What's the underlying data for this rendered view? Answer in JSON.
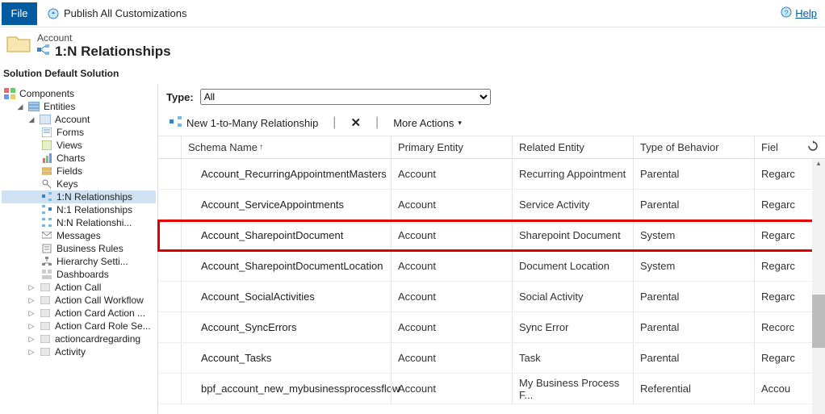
{
  "topbar": {
    "file": "File",
    "publish": "Publish All Customizations",
    "help": "Help"
  },
  "header": {
    "breadcrumb": "Account",
    "title": "1:N Relationships"
  },
  "solution_label": "Solution Default Solution",
  "tree": {
    "components": "Components",
    "entities": "Entities",
    "account": "Account",
    "forms": "Forms",
    "views": "Views",
    "charts": "Charts",
    "fields": "Fields",
    "keys": "Keys",
    "rel_1n": "1:N Relationships",
    "rel_n1": "N:1 Relationships",
    "rel_nn": "N:N Relationshi...",
    "messages": "Messages",
    "business_rules": "Business Rules",
    "hierarchy": "Hierarchy Setti...",
    "dashboards": "Dashboards",
    "action_call": "Action Call",
    "action_call_wf": "Action Call Workflow",
    "action_card_action": "Action Card Action ...",
    "action_card_role": "Action Card Role Se...",
    "actioncardregarding": "actioncardregarding",
    "activity": "Activity"
  },
  "type_row": {
    "label": "Type:",
    "value": "All"
  },
  "toolbar": {
    "new_rel": "New 1-to-Many Relationship",
    "more": "More Actions"
  },
  "columns": {
    "schema": "Schema Name",
    "primary": "Primary Entity",
    "related": "Related Entity",
    "type": "Type of Behavior",
    "field": "Fiel"
  },
  "rows": [
    {
      "schema": "Account_RecurringAppointmentMasters",
      "primary": "Account",
      "related": "Recurring Appointment",
      "type": "Parental",
      "field": "Regarc"
    },
    {
      "schema": "Account_ServiceAppointments",
      "primary": "Account",
      "related": "Service Activity",
      "type": "Parental",
      "field": "Regarc"
    },
    {
      "schema": "Account_SharepointDocument",
      "primary": "Account",
      "related": "Sharepoint Document",
      "type": "System",
      "field": "Regarc"
    },
    {
      "schema": "Account_SharepointDocumentLocation",
      "primary": "Account",
      "related": "Document Location",
      "type": "System",
      "field": "Regarc"
    },
    {
      "schema": "Account_SocialActivities",
      "primary": "Account",
      "related": "Social Activity",
      "type": "Parental",
      "field": "Regarc"
    },
    {
      "schema": "Account_SyncErrors",
      "primary": "Account",
      "related": "Sync Error",
      "type": "Parental",
      "field": "Recorc"
    },
    {
      "schema": "Account_Tasks",
      "primary": "Account",
      "related": "Task",
      "type": "Parental",
      "field": "Regarc"
    },
    {
      "schema": "bpf_account_new_mybusinessprocessflow",
      "primary": "Account",
      "related": "My Business Process F...",
      "type": "Referential",
      "field": "Accou"
    }
  ]
}
